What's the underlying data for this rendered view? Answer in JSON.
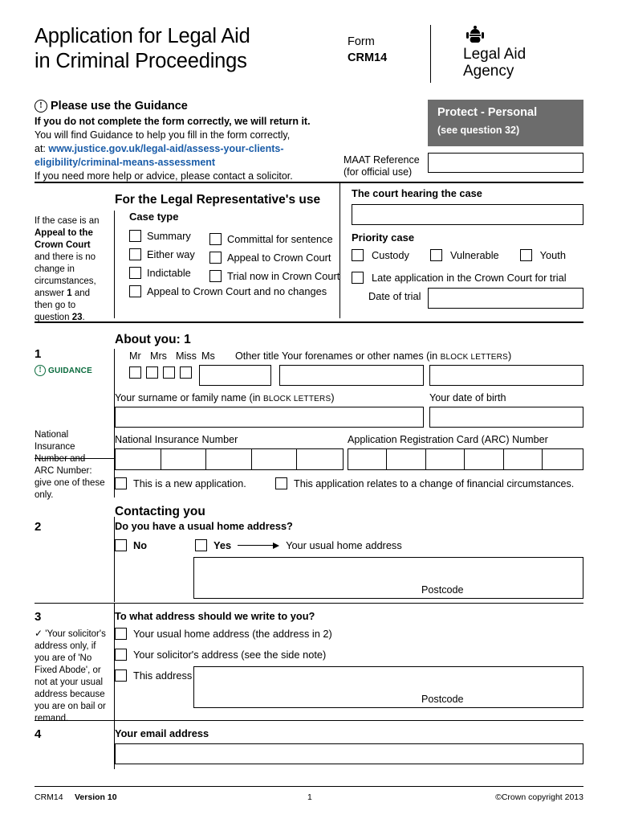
{
  "header": {
    "title_line1": "Application for Legal Aid",
    "title_line2": "in Criminal Proceedings",
    "form_word": "Form",
    "form_code": "CRM14",
    "crown_icon": "royal-crest-icon",
    "logo_line1": "Legal Aid",
    "logo_line2": "Agency"
  },
  "guidance": {
    "heading": "Please use the Guidance",
    "warn_icon": "exclamation-icon",
    "line1": "If you do not complete the form correctly, we will return it.",
    "line2": "You will find Guidance to help you fill in the form correctly,",
    "at_word": "at:",
    "link_line1": "www.justice.gov.uk/legal-aid/assess-your-clients-",
    "link_line2": "eligibility/criminal-means-assessment",
    "line3": "If you need more help or advice, please contact a solicitor.",
    "link_color": "#1a5ca8"
  },
  "protect": {
    "title": "Protect - Personal",
    "subtitle": "(see question 32)",
    "bg_color": "#6c6c6c"
  },
  "maat": {
    "label_line1": "MAAT Reference",
    "label_line2": "(for official use)",
    "value": ""
  },
  "legal_rep": {
    "section_title": "For the Legal Representative's use",
    "sidenote": {
      "t1": "If the case is an ",
      "t2": "Appeal to the Crown Court",
      "t3": " and there is no change in circumstances, answer ",
      "t4": "1",
      "t5": " and then go to question ",
      "t6": "23",
      "t7": "."
    },
    "case_type_label": "Case type",
    "case_type_col1": [
      "Summary",
      "Either way",
      "Indictable",
      "Appeal to Crown Court and no changes"
    ],
    "case_type_col2": [
      "Committal for sentence",
      "Appeal to Crown Court",
      "Trial now in Crown Court"
    ],
    "court_label": "The court hearing the case",
    "court_value": "",
    "priority_label": "Priority case",
    "priority_options": [
      "Custody",
      "Vulnerable",
      "Youth"
    ],
    "late_application": "Late application in the Crown Court for trial",
    "date_of_trial_label": "Date of trial",
    "date_of_trial_value": ""
  },
  "about_you": {
    "section_title": "About you: 1",
    "q1_number": "1",
    "guidance_tag": "Guidance",
    "guidance_tag_icon": "exclamation-icon",
    "titles": [
      "Mr",
      "Mrs",
      "Miss",
      "Ms"
    ],
    "other_title_label": "Other title",
    "other_title_value": "",
    "forenames_label_main": "Your forenames or other names (in ",
    "forenames_label_caps": "BLOCK LETTERS",
    "forenames_label_end": ")",
    "forenames_value": "",
    "surname_label_main": "Your surname or family name (in ",
    "surname_label_caps": "BLOCK LETTERS",
    "surname_label_end": ")",
    "surname_value": "",
    "dob_label": "Your date of birth",
    "dob_value": "",
    "ni_sidenote": "National Insurance Number and ARC Number: give one of these only.",
    "ni_label": "National Insurance Number",
    "ni_value": "",
    "arc_label": "Application Registration Card (ARC) Number",
    "arc_value": "",
    "new_application": "This is a new application.",
    "change_of_circumstances": "This application relates to a change of financial circumstances."
  },
  "contacting": {
    "section_title": "Contacting you",
    "q2_number": "2",
    "q2_label": "Do you have a usual home address?",
    "no_label": "No",
    "yes_label": "Yes",
    "usual_home_address_label": "Your usual home address",
    "address_value": "",
    "postcode_label": "Postcode",
    "postcode_value": "",
    "q3_number": "3",
    "q3_label": "To what address should we write to you?",
    "q3_sidenote_tick": "✓",
    "q3_sidenote": "'Your solicitor's address only, if you are of 'No Fixed Abode', or not at your usual address because you are on bail or remand.",
    "q3_options": [
      "Your usual home address (the address in 2)",
      "Your solicitor's address (see the side note)",
      "This address"
    ],
    "q3_address_value": "",
    "q3_postcode_label": "Postcode",
    "q4_number": "4",
    "q4_label": "Your email address",
    "q4_value": ""
  },
  "footer": {
    "form": "CRM14",
    "version": "Version 10",
    "page": "1",
    "copyright": "©Crown copyright 2013"
  }
}
